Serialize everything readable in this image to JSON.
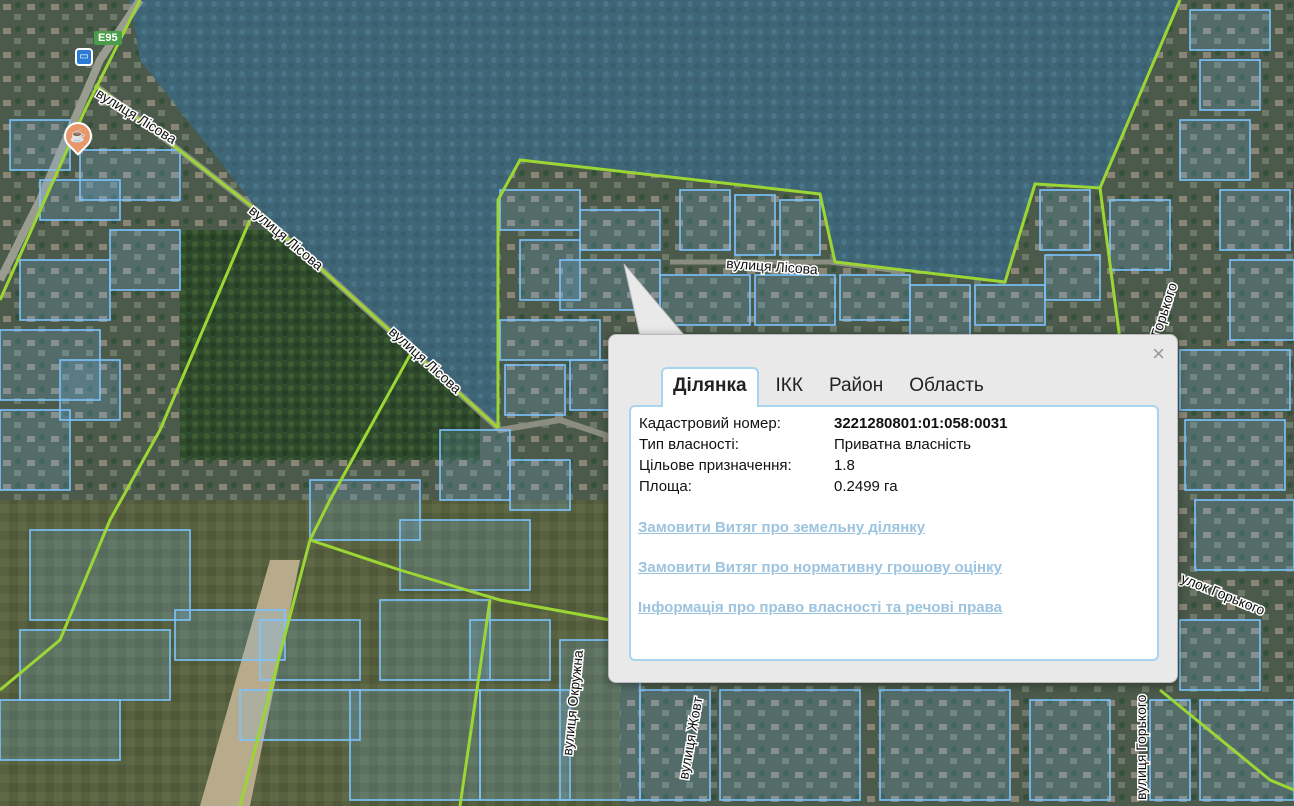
{
  "map": {
    "road_badge": "E95",
    "bus_stop_icon": "bus-icon",
    "cafe_icon": "cafe-icon",
    "streets": [
      "вулиця Лісова",
      "вулиця Лісова",
      "вулиця Лісова",
      "вулиця Лісова",
      "улок Горького",
      "Горького",
      "вулиця Окружна",
      "вулиця Жовт",
      "вулиця Горького"
    ],
    "colors": {
      "parcel_outline": "#7cc4ff",
      "boundary_outline": "#9bd635",
      "forest": "#3b6a78",
      "field": "#4e5a3c"
    }
  },
  "popup": {
    "close_symbol": "×",
    "tabs": [
      "Ділянка",
      "ІКК",
      "Район",
      "Область"
    ],
    "active_tab": "Ділянка",
    "fields": [
      {
        "label": "Кадастровий номер:",
        "value": "3221280801:01:058:0031"
      },
      {
        "label": "Тип власності:",
        "value": "Приватна власність"
      },
      {
        "label": "Цільове призначення:",
        "value": "1.8"
      },
      {
        "label": "Площа:",
        "value": "0.2499 га"
      }
    ],
    "links": [
      "Замовити Витяг про земельну ділянку",
      "Замовити Витяг про нормативну грошову оцінку",
      "Інформація про право власності та речові права"
    ]
  }
}
